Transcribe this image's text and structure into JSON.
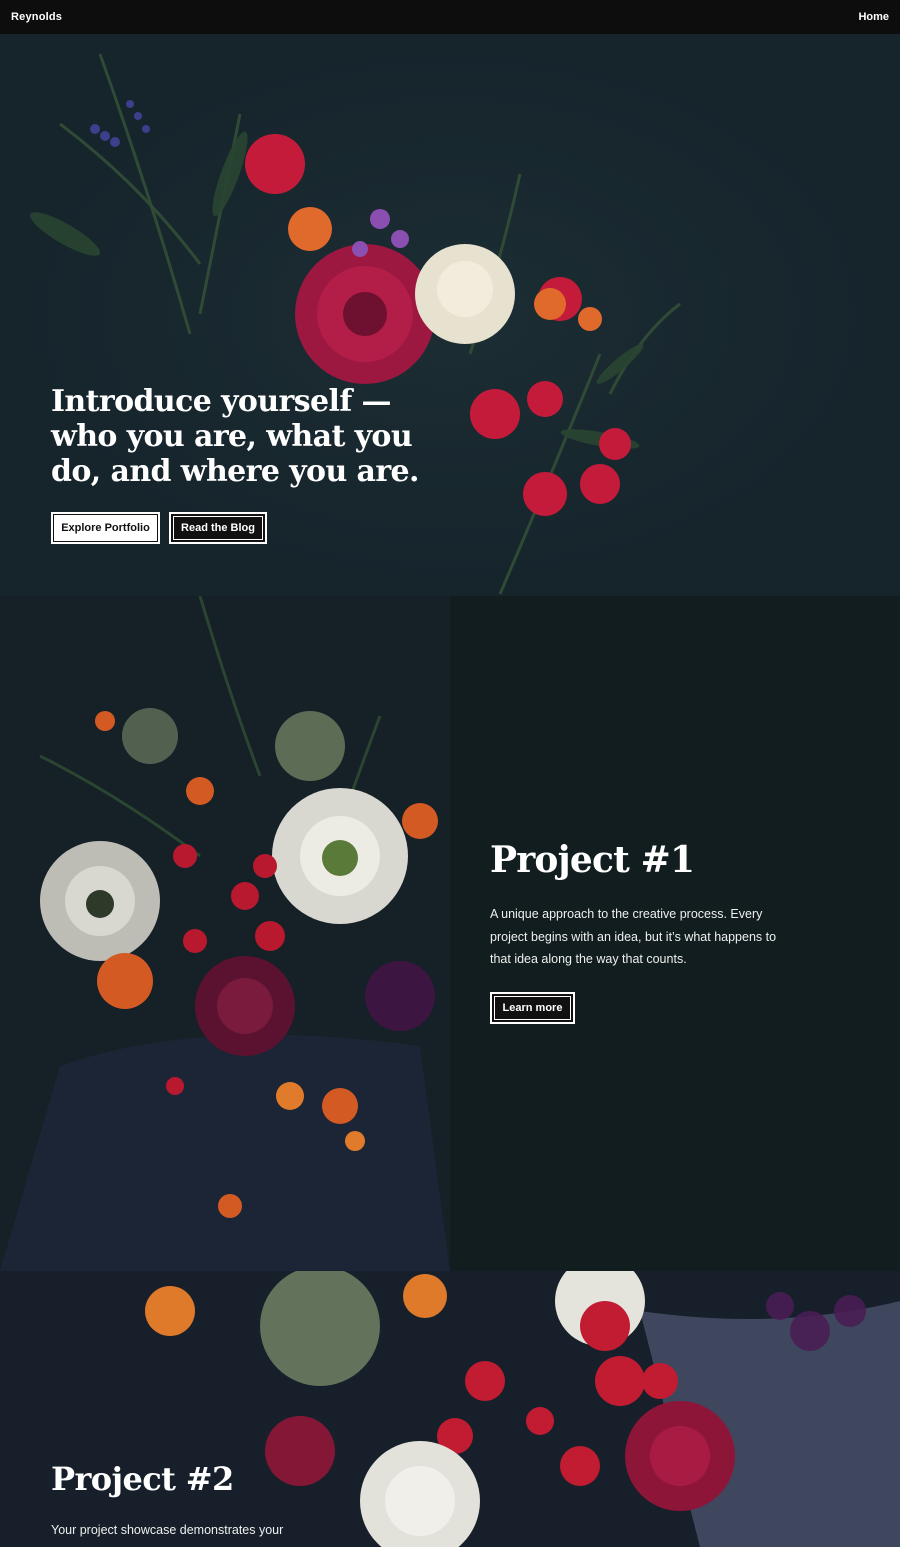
{
  "nav": {
    "brand": "Reynolds",
    "home": "Home"
  },
  "hero": {
    "title": "Introduce yourself — who you are, what you do, and where you are.",
    "primary_button": "Explore Portfolio",
    "secondary_button": "Read the Blog"
  },
  "project1": {
    "title": "Project #1",
    "description": "A unique approach to the creative process. Every project begins with an idea, but it’s what happens to that idea along the way that counts.",
    "button": "Learn more"
  },
  "project2": {
    "title": "Project #2",
    "description": "Your project showcase demonstrates your"
  },
  "colors": {
    "topbar": "#0d0d0d",
    "hero_bg": "#16242c",
    "dark_panel": "#121d1f",
    "text": "#ffffff"
  }
}
